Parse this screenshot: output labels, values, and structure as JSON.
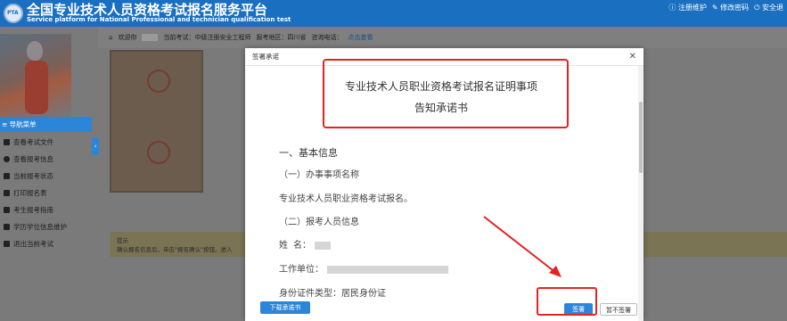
{
  "header": {
    "title": "全国专业技术人员资格考试报名服务平台",
    "subtitle": "Service platform for National Professional and technician qualification test",
    "links": [
      "注册维护",
      "修改密码",
      "安全退"
    ]
  },
  "sidebar": {
    "nav_head": "导航菜单",
    "items": [
      {
        "label": "查看考试文件",
        "icon": "document-icon"
      },
      {
        "label": "查看报考信息",
        "icon": "info-icon"
      },
      {
        "label": "当前报考状态",
        "icon": "monitor-icon"
      },
      {
        "label": "打印报名表",
        "icon": "print-icon"
      },
      {
        "label": "考生报考指南",
        "icon": "book-icon"
      },
      {
        "label": "学历学位信息维护",
        "icon": "graduation-icon"
      },
      {
        "label": "退出当前考试",
        "icon": "logout-icon"
      }
    ]
  },
  "infobar": {
    "welcome": "欢迎你",
    "exam": "当前考试：中级注册安全工程师",
    "region": "报考地区：四川省",
    "phone_label": "咨询电话：",
    "phone_link": "点击查看"
  },
  "tip": {
    "title": "提示",
    "text": "确认报名信息后，单击\"报名确认\"按钮。进入"
  },
  "modal": {
    "title": "签署承诺",
    "doc_title_1": "专业技术人员职业资格考试报名证明事项",
    "doc_title_2": "告知承诺书",
    "section1": "一、基本信息",
    "sub1": "（一）办事事项名称",
    "item_name": "专业技术人员职业资格考试报名。",
    "sub2": "（二）报考人员信息",
    "name_label": "姓    名：",
    "employer_label": "工作单位：",
    "id_type": "身份证件类型：居民身份证",
    "download_btn": "下载承诺书",
    "sign_btn": "签署",
    "nosign_btn": "暂不签署"
  },
  "colors": {
    "primary": "#2b86d9",
    "header": "#1a6fc0",
    "annotation": "#e52222"
  }
}
